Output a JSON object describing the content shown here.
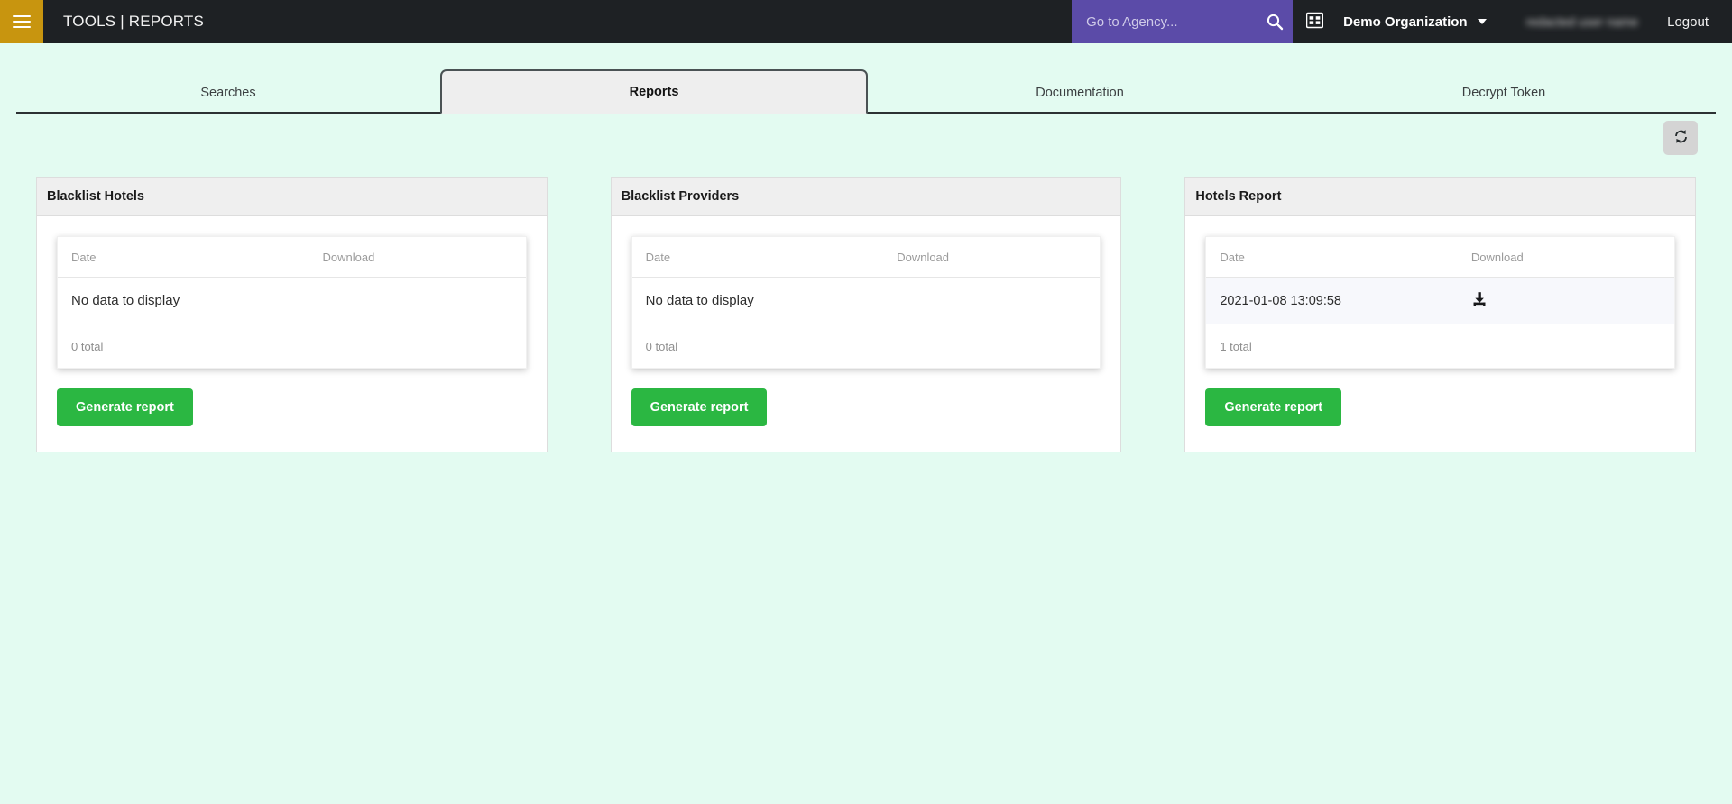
{
  "navbar": {
    "menu_icon": "hamburger-icon",
    "brand_title": "TOOLS | REPORTS",
    "search": {
      "placeholder": "Go to Agency...",
      "value": "",
      "icon": "search-icon",
      "background": "#5b4ba8"
    },
    "apps_icon": "grid-apps-icon",
    "organization": {
      "label": "Demo Organization",
      "caret_icon": "caret-down-icon"
    },
    "user_name": "redacted user name",
    "logout_label": "Logout",
    "background": "#1e2124",
    "menu_background": "#c8950f"
  },
  "tabs": [
    {
      "label": "Searches",
      "active": false
    },
    {
      "label": "Reports",
      "active": true
    },
    {
      "label": "Documentation",
      "active": false
    },
    {
      "label": "Decrypt Token",
      "active": false
    }
  ],
  "toolbar": {
    "refresh_icon": "refresh-icon",
    "refresh_title": "Refresh"
  },
  "columns": {
    "date": "Date",
    "download": "Download"
  },
  "labels": {
    "empty": "No data to display",
    "generate": "Generate report",
    "download_icon": "download-icon"
  },
  "cards": [
    {
      "title": "Blacklist Hotels",
      "rows": [],
      "total": "0 total",
      "empty": "No data to display",
      "generate": "Generate report"
    },
    {
      "title": "Blacklist Providers",
      "rows": [],
      "total": "0 total",
      "empty": "No data to display",
      "generate": "Generate report"
    },
    {
      "title": "Hotels Report",
      "rows": [
        {
          "date": "2021-01-08 13:09:58",
          "download": "download-icon"
        }
      ],
      "total": "1 total",
      "empty": "",
      "generate": "Generate report"
    }
  ],
  "theme": {
    "page_background": "#e3fbf1",
    "accent_green": "#2bb742",
    "accent_purple": "#5b4ba8",
    "accent_gold": "#c8950f"
  }
}
